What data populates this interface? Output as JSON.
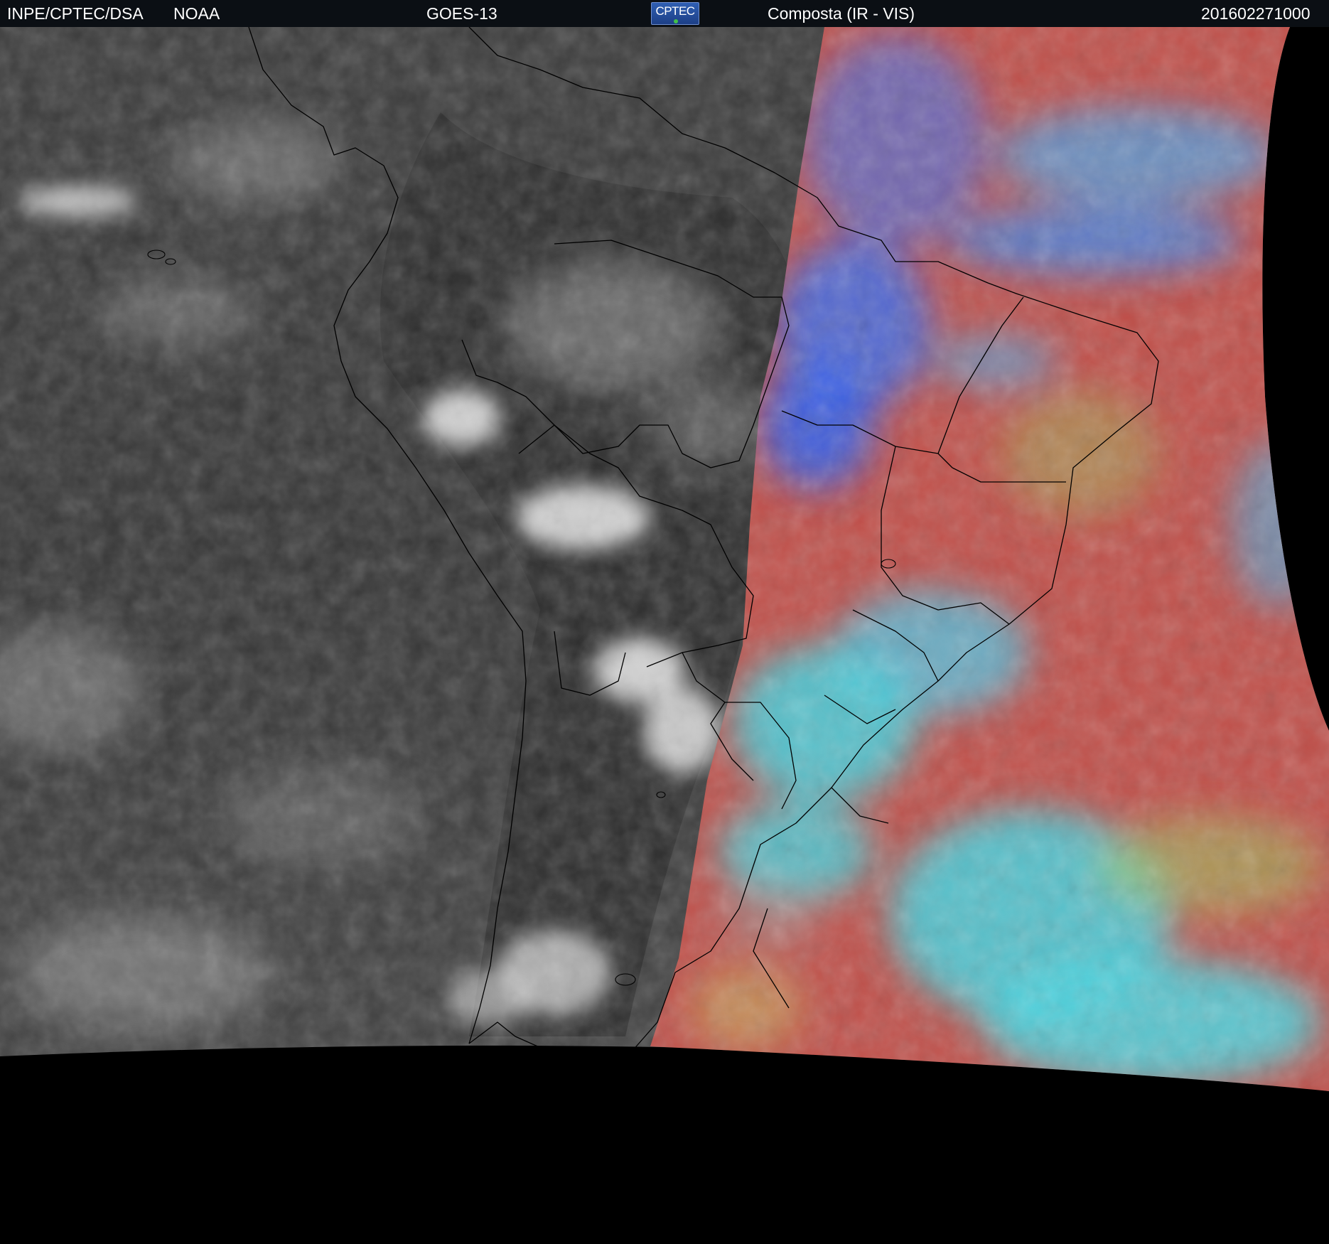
{
  "header": {
    "org": "INPE/CPTEC/DSA",
    "agency": "NOAA",
    "satellite": "GOES-13",
    "logo_text": "CPTEC",
    "product": "Composta (IR - VIS)",
    "timestamp": "201602271000"
  },
  "colors": {
    "header_bg": "#0b0f14",
    "ir_gray": "#3a3a3a",
    "vis_red": "#c0504a",
    "vis_cyan": "#45d4e0",
    "vis_blue": "#3a6ef0",
    "outline": "#000000",
    "space": "#000000"
  }
}
